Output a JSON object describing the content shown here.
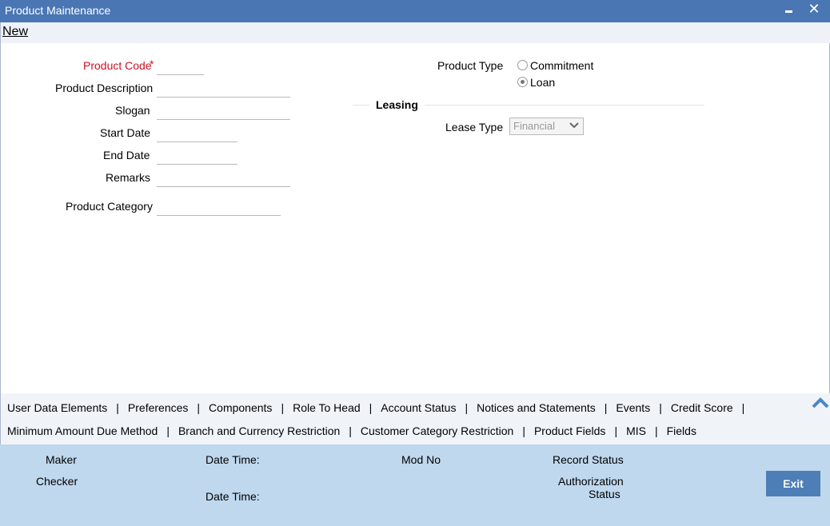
{
  "window": {
    "title": "Product Maintenance",
    "close_glyph": "✕"
  },
  "menu": {
    "new_label": "New"
  },
  "form": {
    "product_code": {
      "label": "Product Code",
      "required_mark": "*",
      "value": ""
    },
    "product_description": {
      "label": "Product Description",
      "value": ""
    },
    "slogan": {
      "label": "Slogan",
      "value": ""
    },
    "start_date": {
      "label": "Start Date",
      "value": ""
    },
    "end_date": {
      "label": "End Date",
      "value": ""
    },
    "remarks": {
      "label": "Remarks",
      "value": ""
    },
    "product_category": {
      "label": "Product Category",
      "value": ""
    },
    "product_type": {
      "label": "Product Type",
      "options": [
        "Commitment",
        "Loan"
      ],
      "selected": "Loan"
    },
    "leasing": {
      "section_title": "Leasing",
      "lease_type": {
        "label": "Lease Type",
        "value": "Financial",
        "disabled": true
      }
    }
  },
  "tabs": {
    "row1": [
      "User Data Elements",
      "Preferences",
      "Components",
      "Role To Head",
      "Account Status",
      "Notices and Statements",
      "Events",
      "Credit Score"
    ],
    "row2": [
      "Minimum Amount Due Method",
      "Branch and Currency Restriction",
      "Customer Category Restriction",
      "Product Fields",
      "MIS",
      "Fields"
    ],
    "separator": "|"
  },
  "footer": {
    "maker": "Maker",
    "checker": "Checker",
    "date_time_1": "Date Time:",
    "date_time_2": "Date Time:",
    "mod_no": "Mod No",
    "record_status": "Record Status",
    "authorization": "Authorization",
    "status": "Status",
    "exit_label": "Exit"
  },
  "colors": {
    "titlebar": "#4a76b4",
    "required": "#cc1122",
    "footer": "#bfd8ee",
    "exit_button": "#4d7fb6"
  },
  "icons": {
    "minimize": "minimize-icon",
    "close": "close-icon",
    "dropdown": "chevron-down-icon",
    "collapse": "chevron-up-icon"
  }
}
